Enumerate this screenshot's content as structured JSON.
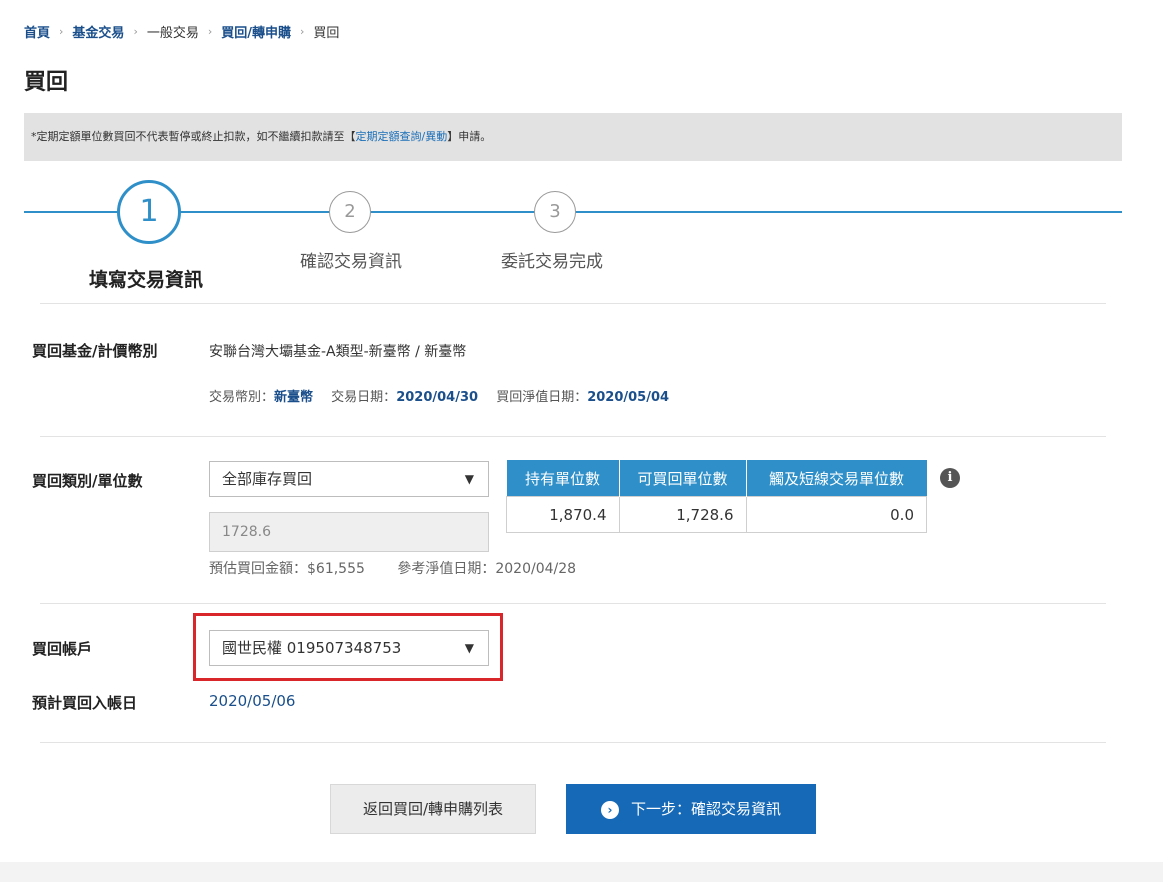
{
  "breadcrumb": {
    "items": [
      "首頁",
      "基金交易",
      "一般交易",
      "買回/轉申購",
      "買回"
    ],
    "separator": "›"
  },
  "page_title": "買回",
  "notice": {
    "prefix": "*定期定額單位數買回不代表暫停或終止扣款，如不繼續扣款請至【",
    "link": "定期定額查詢/異動",
    "suffix": "】申請。"
  },
  "steps": [
    {
      "number": "1",
      "label": "填寫交易資訊"
    },
    {
      "number": "2",
      "label": "確認交易資訊"
    },
    {
      "number": "3",
      "label": "委託交易完成"
    }
  ],
  "fund": {
    "label": "買回基金/計價幣別",
    "name": "安聯台灣大壩基金-A類型-新臺幣 / 新臺幣",
    "currency_label": "交易幣別：",
    "currency_value": "新臺幣",
    "trade_date_label": "交易日期：",
    "trade_date_value": "2020/04/30",
    "nav_date_label": "買回淨值日期：",
    "nav_date_value": "2020/05/04"
  },
  "redeem_type": {
    "label": "買回類別/單位數",
    "selected": "全部庫存買回",
    "units_value": "1728.6",
    "estimate_text": "預估買回金額：$61,555",
    "ref_nav_date_text": "參考淨值日期：2020/04/28"
  },
  "units_table": {
    "headers": [
      "持有單位數",
      "可買回單位數",
      "觸及短線交易單位數"
    ],
    "values": [
      "1,870.4",
      "1,728.6",
      "0.0"
    ]
  },
  "account": {
    "label": "買回帳戶",
    "selected": "國世民權 019507348753",
    "deposit_label": "預計買回入帳日",
    "deposit_date": "2020/05/06"
  },
  "buttons": {
    "back": "返回買回/轉申購列表",
    "next": "下一步：確認交易資訊"
  },
  "colors": {
    "accent": "#2f8fc8",
    "primary_button": "#1669b6",
    "highlight": "#d8262a"
  }
}
